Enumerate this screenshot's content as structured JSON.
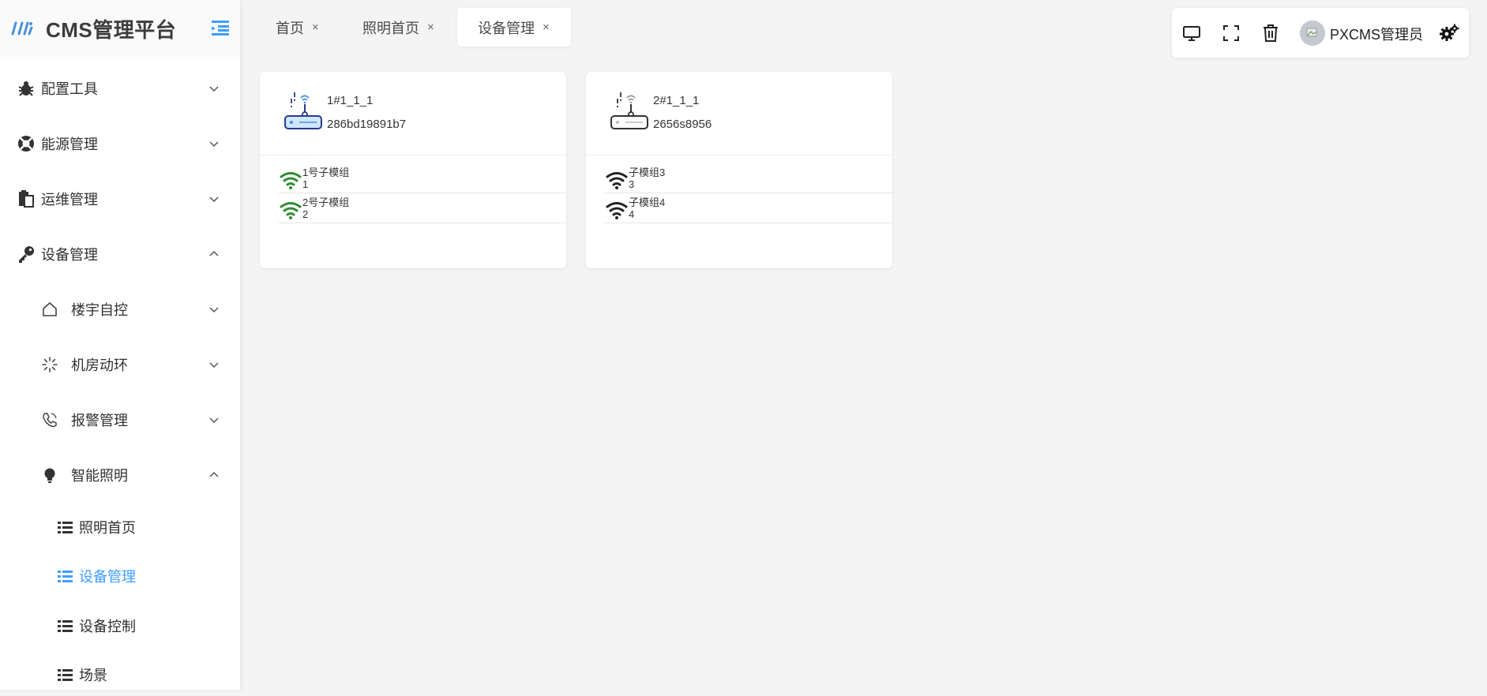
{
  "app": {
    "title": "CMS管理平台"
  },
  "sidebar": {
    "items": [
      {
        "label": "配置工具",
        "icon": "bug-icon",
        "expanded": false
      },
      {
        "label": "能源管理",
        "icon": "lifebuoy-icon",
        "expanded": false
      },
      {
        "label": "运维管理",
        "icon": "clipboard-icon",
        "expanded": false
      },
      {
        "label": "设备管理",
        "icon": "key-icon",
        "expanded": true
      },
      {
        "label": "楼宇自控",
        "icon": "home-icon",
        "expanded": false
      },
      {
        "label": "机房动环",
        "icon": "loading-icon",
        "expanded": false
      },
      {
        "label": "报警管理",
        "icon": "phone-icon",
        "expanded": false
      },
      {
        "label": "智能照明",
        "icon": "bulb-icon",
        "expanded": true
      },
      {
        "label": "照明首页",
        "icon": "list-icon",
        "active": false
      },
      {
        "label": "设备管理",
        "icon": "list-icon",
        "active": true
      },
      {
        "label": "设备控制",
        "icon": "list-icon",
        "active": false
      },
      {
        "label": "场景",
        "icon": "list-icon",
        "active": false
      }
    ]
  },
  "tabs": [
    {
      "label": "首页",
      "close": "×",
      "active": false
    },
    {
      "label": "照明首页",
      "close": "×",
      "active": false
    },
    {
      "label": "设备管理",
      "close": "×",
      "active": true
    }
  ],
  "toolbar": {
    "icons": [
      "monitor-icon",
      "fullscreen-icon",
      "trash-icon",
      "settings-gears-icon"
    ],
    "user": "PXCMS管理员"
  },
  "devices": [
    {
      "name": "1#1_1_1",
      "id": "286bd19891b7",
      "online": true,
      "submodules": [
        {
          "name": "1号子模组",
          "num": "1",
          "status_color": "#2e8b2e"
        },
        {
          "name": "2号子模组",
          "num": "2",
          "status_color": "#2e8b2e"
        }
      ]
    },
    {
      "name": "2#1_1_1",
      "id": "2656s8956",
      "online": false,
      "submodules": [
        {
          "name": "子模组3",
          "num": "3",
          "status_color": "#222222"
        },
        {
          "name": "子模组4",
          "num": "4",
          "status_color": "#222222"
        }
      ]
    }
  ],
  "colors": {
    "accent": "#409eff",
    "online": "#2e8b2e",
    "offline": "#222222"
  }
}
